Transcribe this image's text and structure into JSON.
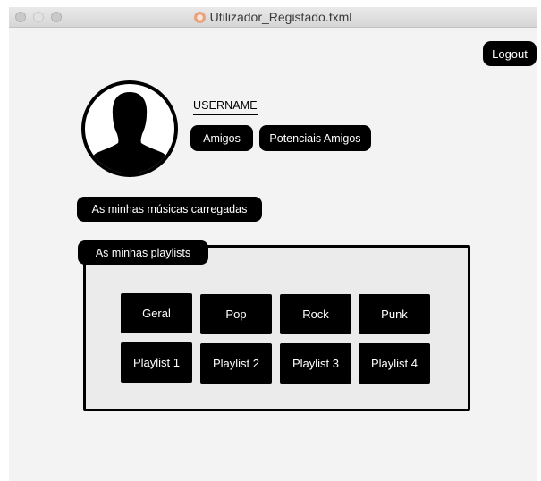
{
  "window": {
    "title": "Utilizador_Registado.fxml"
  },
  "header": {
    "logout_label": "Logout"
  },
  "profile": {
    "username": "USERNAME",
    "friends_label": "Amigos",
    "potential_friends_label": "Potenciais Amigos"
  },
  "music": {
    "uploaded_label": "As minhas músicas carregadas"
  },
  "playlists": {
    "section_label": "As minhas playlists",
    "buttons": [
      "Geral",
      "Pop",
      "Rock",
      "Punk",
      "Playlist 1",
      "Playlist 2",
      "Playlist 3",
      "Playlist 4"
    ]
  },
  "icons": {
    "avatar": "person-silhouette-icon",
    "app": "app-icon"
  },
  "colors": {
    "button_bg": "#000000",
    "button_text": "#ffffff",
    "background": "#f3f3f3",
    "panel_bg": "#ebebeb"
  }
}
